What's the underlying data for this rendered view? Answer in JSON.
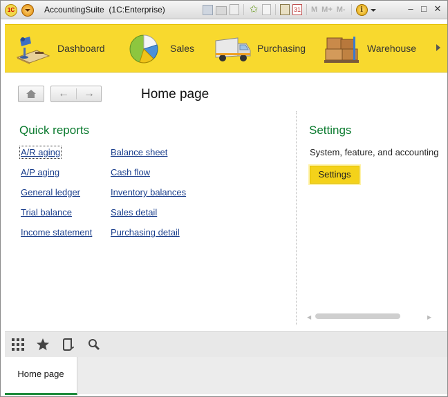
{
  "window": {
    "title": "AccountingSuite",
    "platform": "(1C:Enterprise)",
    "mem_buttons": [
      "M",
      "M+",
      "M-"
    ]
  },
  "sections": [
    {
      "label": "Dashboard",
      "icon": "dashboard-icon"
    },
    {
      "label": "Sales",
      "icon": "sales-pie-chart-icon"
    },
    {
      "label": "Purchasing",
      "icon": "purchasing-truck-icon"
    },
    {
      "label": "Warehouse",
      "icon": "warehouse-boxes-icon"
    }
  ],
  "page": {
    "title": "Home page"
  },
  "quick_reports": {
    "title": "Quick reports",
    "col1": [
      "A/R aging",
      "A/P aging",
      "General ledger",
      "Trial balance",
      "Income statement"
    ],
    "col2": [
      "Balance sheet",
      "Cash flow",
      "Inventory balances",
      "Sales detail",
      "Purchasing detail"
    ]
  },
  "settings": {
    "title": "Settings",
    "description": "System, feature, and accounting",
    "button_label": "Settings"
  },
  "open_windows": {
    "tab": "Home page"
  },
  "colors": {
    "section_bar": "#f8d92e",
    "group_title": "#0a7a2e",
    "link": "#1a3e8c",
    "active_tab_underline": "#1c8a3a"
  }
}
